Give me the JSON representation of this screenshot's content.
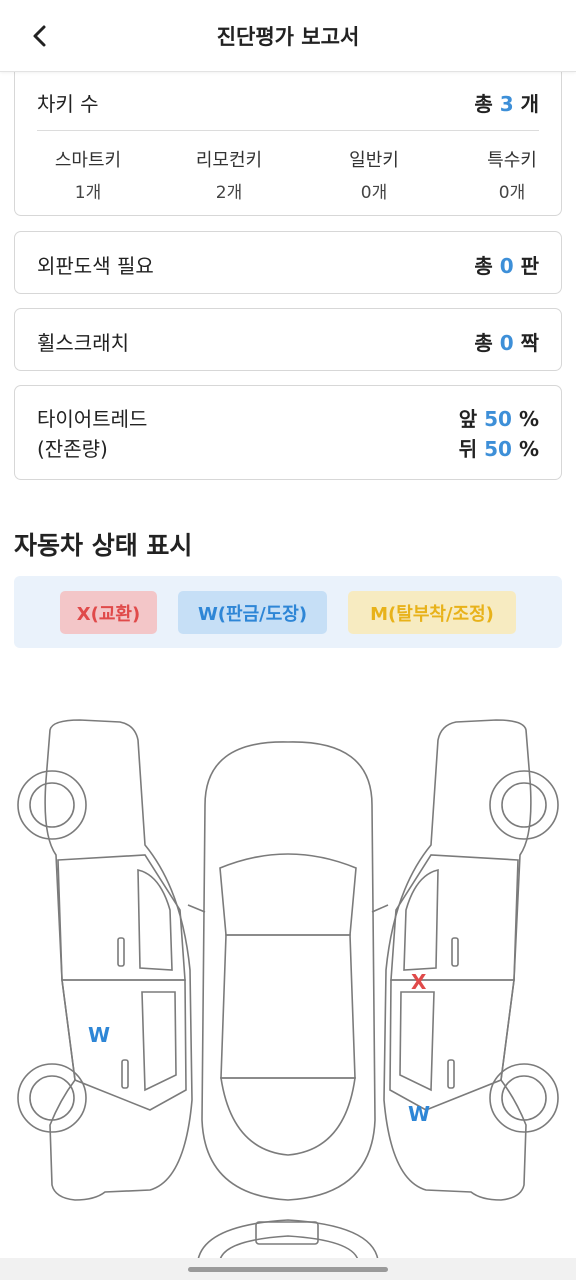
{
  "header": {
    "title": "진단평가 보고서",
    "back_icon": "chevron-left-icon"
  },
  "keys": {
    "label": "차키 수",
    "total_prefix": "총",
    "total": "3",
    "total_unit": "개",
    "types": [
      {
        "name": "스마트키",
        "count": "1개"
      },
      {
        "name": "리모컨키",
        "count": "2개"
      },
      {
        "name": "일반키",
        "count": "0개"
      },
      {
        "name": "특수키",
        "count": "0개"
      }
    ]
  },
  "paint": {
    "label": "외판도색 필요",
    "prefix": "총",
    "value": "0",
    "unit": "판"
  },
  "wheel": {
    "label": "휠스크래치",
    "prefix": "총",
    "value": "0",
    "unit": "짝"
  },
  "tire": {
    "label_line1": "타이어트레드",
    "label_line2": "(잔존량)",
    "front_label": "앞",
    "front_value": "50",
    "rear_label": "뒤",
    "rear_value": "50",
    "unit": "%"
  },
  "status_section": {
    "title": "자동차 상태 표시",
    "legend": [
      {
        "label": "X(교환)",
        "color": "#e04a4a"
      },
      {
        "label": "W(판금/도장)",
        "color": "#2e86d6"
      },
      {
        "label": "M(탈부착/조정)",
        "color": "#e8b21a"
      }
    ],
    "marks": [
      {
        "code": "W",
        "part": "left-rear-door"
      },
      {
        "code": "X",
        "part": "right-front-door"
      },
      {
        "code": "W",
        "part": "right-front-fender"
      }
    ]
  },
  "colors": {
    "accent": "#3d8fd8",
    "border": "#d7d7d7"
  }
}
